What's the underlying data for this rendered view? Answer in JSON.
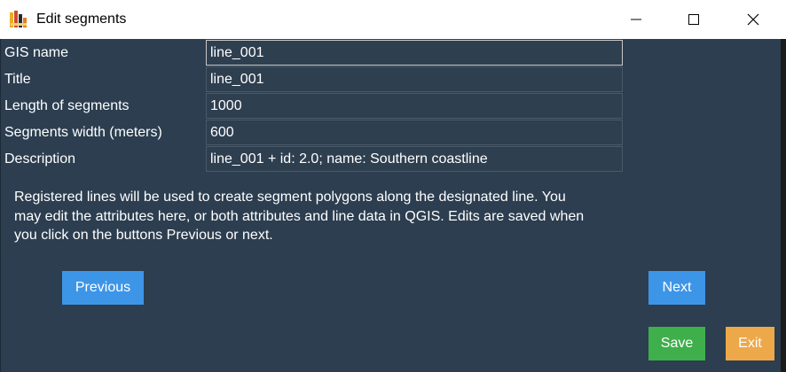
{
  "window": {
    "title": "Edit segments",
    "icon": "qgis-app-icon",
    "controls": [
      "minimize-icon",
      "maximize-icon",
      "close-icon"
    ]
  },
  "form": {
    "gis_name_label": "GIS name",
    "gis_name_value": "line_001",
    "title_label": "Title",
    "title_value": "line_001",
    "length_label": "Length of segments",
    "length_value": "1000",
    "width_label": "Segments width (meters)",
    "width_value": "600",
    "description_label": "Description",
    "description_value": "line_001 + id: 2.0; name: Southern coastline"
  },
  "info": {
    "line1": "Registered lines will be used to create segment polygons along the designated line. You",
    "line2": "may edit the attributes here, or both attributes and line data in QGIS. Edits are saved when",
    "line3": "you click on the buttons Previous or next."
  },
  "buttons": {
    "previous": "Previous",
    "next": "Next",
    "save": "Save",
    "exit": "Exit"
  },
  "colors": {
    "background": "#2c3e50",
    "field_background": "#2e3f50",
    "primary_button": "#3d95e8",
    "save_button": "#3faf4c",
    "exit_button": "#eda84a"
  }
}
